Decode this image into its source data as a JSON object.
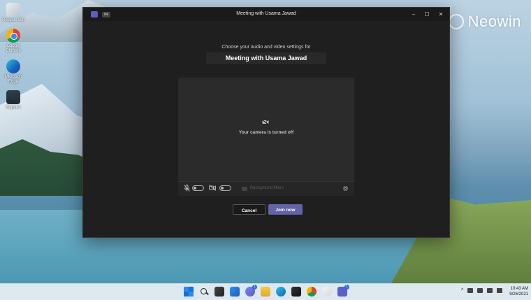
{
  "desktop": {
    "icons": [
      {
        "label": "Recycle Bin",
        "icon": "recycle-bin-icon"
      },
      {
        "label": "Google Chrome",
        "icon": "chrome-icon"
      },
      {
        "label": "Microsoft Edge",
        "icon": "edge-icon"
      },
      {
        "label": "Capture",
        "icon": "capture-icon"
      }
    ],
    "watermark": "Neowin"
  },
  "window": {
    "title": "Meeting with Usama Jawad",
    "badge": "04",
    "controls": {
      "minimize": "–",
      "maximize": "☐",
      "close": "✕"
    }
  },
  "prejoin": {
    "subtitle": "Choose your audio and video settings for",
    "meeting_name": "Meeting with Usama Jawad",
    "camera_status": "Your camera is turned off",
    "background_filters_label": "Background filters",
    "mic_enabled": false,
    "camera_enabled": false
  },
  "actions": {
    "cancel_label": "Cancel",
    "join_label": "Join now"
  },
  "taskbar": {
    "chat_badge": "1",
    "teams_badge": "1",
    "time": "10:43 AM",
    "date": "9/26/2021"
  },
  "colors": {
    "accent": "#6264a7",
    "window_bg": "#1f1f1f",
    "preview_bg": "#2b2b2b"
  }
}
